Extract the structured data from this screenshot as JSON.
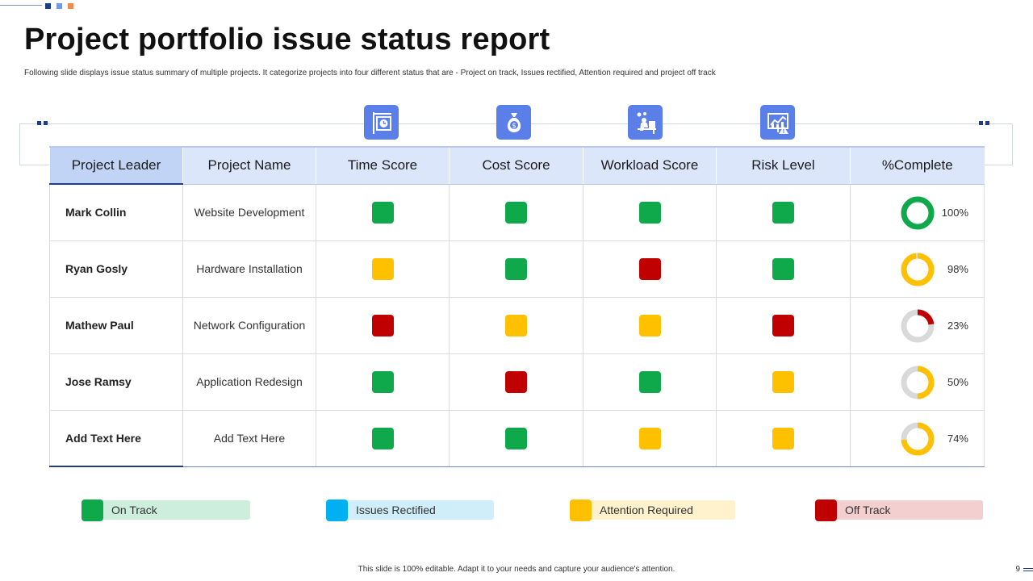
{
  "title": "Project portfolio issue status report",
  "subtitle": "Following slide displays issue status summary of multiple  projects. It categorize projects into four different status that are - Project on track, Issues rectified, Attention required and project off track",
  "colors": {
    "green": "#0fa84a",
    "blue": "#00b0f0",
    "amber": "#ffc000",
    "red": "#c00000",
    "accent": "#1f3c88",
    "icon_bg": "#5b7fe8"
  },
  "header_icons": [
    "signboard-clock-icon",
    "money-bag-icon",
    "workload-desk-icon",
    "risk-chart-icon"
  ],
  "table": {
    "headers": [
      "Project Leader",
      "Project Name",
      "Time Score",
      "Cost Score",
      "Workload Score",
      "Risk Level",
      "%Complete"
    ],
    "rows": [
      {
        "leader": "Mark Collin",
        "project": "Website Development",
        "time": "green",
        "cost": "green",
        "workload": "green",
        "risk": "green",
        "complete_label": "100%",
        "complete": 100,
        "ring_color": "green"
      },
      {
        "leader": "Ryan Gosly",
        "project": "Hardware  Installation",
        "time": "amber",
        "cost": "green",
        "workload": "red",
        "risk": "green",
        "complete_label": "98%",
        "complete": 98,
        "ring_color": "amber"
      },
      {
        "leader": "Mathew Paul",
        "project": "Network Configuration",
        "time": "red",
        "cost": "amber",
        "workload": "amber",
        "risk": "red",
        "complete_label": "23%",
        "complete": 23,
        "ring_color": "red"
      },
      {
        "leader": "Jose Ramsy",
        "project": "Application Redesign",
        "time": "green",
        "cost": "red",
        "workload": "green",
        "risk": "amber",
        "complete_label": "50%",
        "complete": 50,
        "ring_color": "amber"
      },
      {
        "leader": "Add Text Here",
        "project": "Add Text Here",
        "time": "green",
        "cost": "green",
        "workload": "amber",
        "risk": "amber",
        "complete_label": "74%",
        "complete": 74,
        "ring_color": "amber"
      }
    ]
  },
  "legend": [
    {
      "label": "On Track",
      "color": "#0fa84a",
      "bg": "#cdeedc"
    },
    {
      "label": "Issues Rectified",
      "color": "#00b0f0",
      "bg": "#cfeef9"
    },
    {
      "label": "Attention Required",
      "color": "#ffc000",
      "bg": "#fff2cc"
    },
    {
      "label": "Off Track",
      "color": "#c00000",
      "bg": "#f3cfd0"
    }
  ],
  "footer": "This slide is 100% editable.  Adapt it to your needs and capture your audience's attention.",
  "page_number": "9"
}
